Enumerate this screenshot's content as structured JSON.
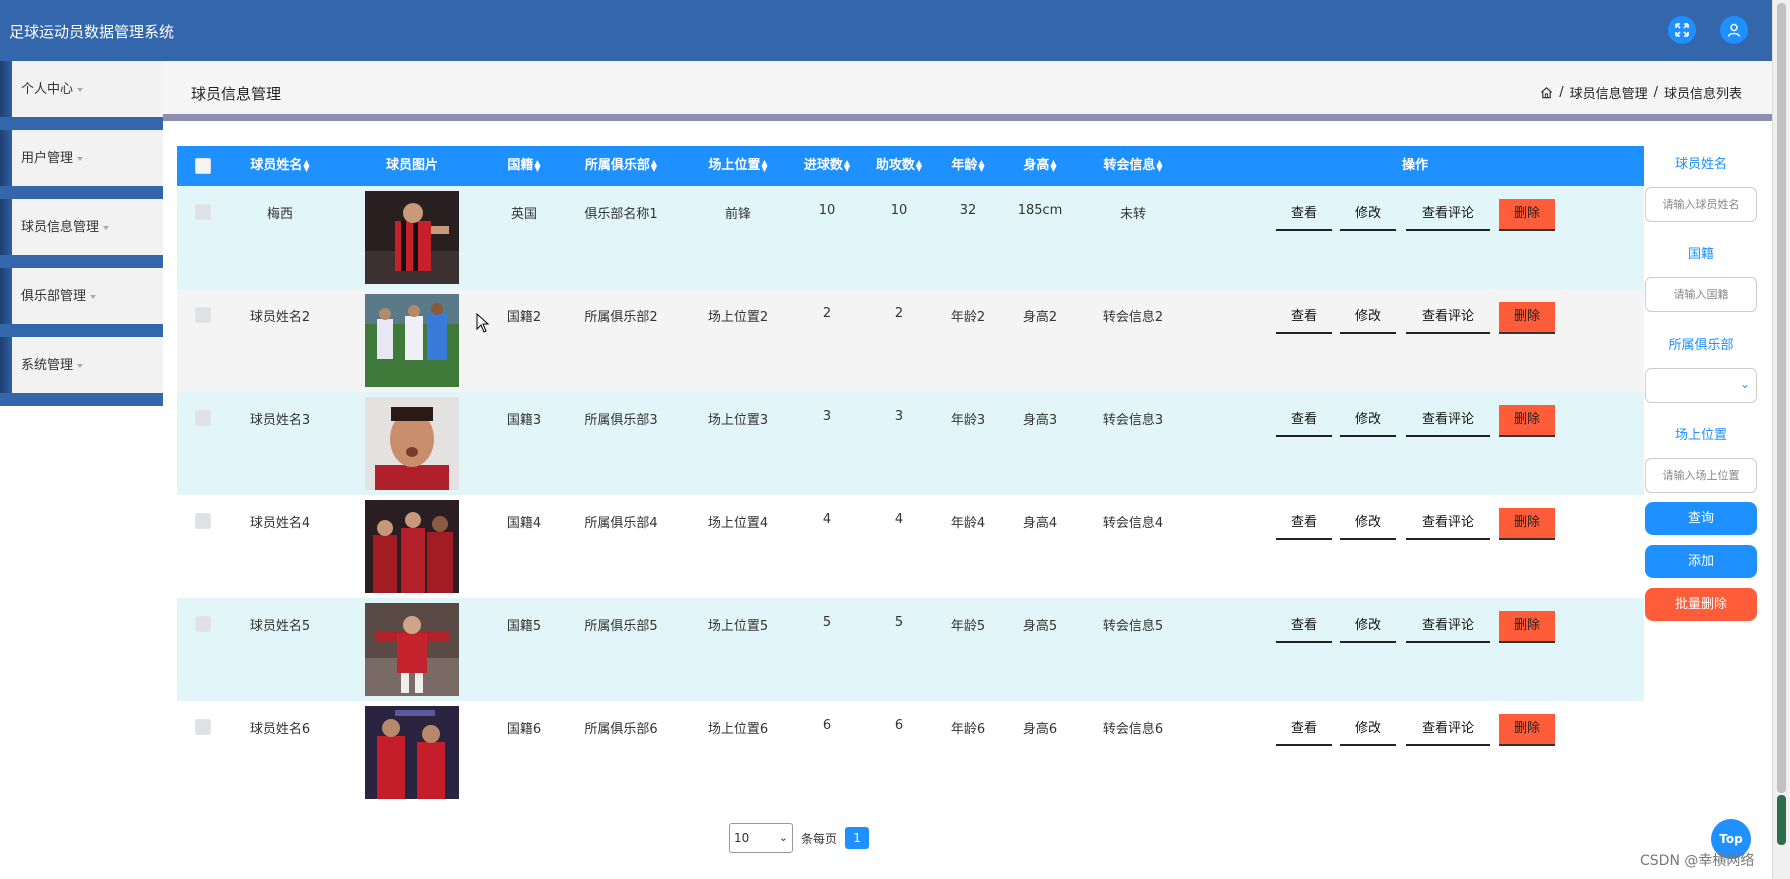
{
  "app": {
    "title": "足球运动员数据管理系统"
  },
  "header": {
    "icons": [
      "fullscreen-icon",
      "user-icon"
    ]
  },
  "sidebar": {
    "items": [
      {
        "label": "个人中心"
      },
      {
        "label": "用户管理"
      },
      {
        "label": "球员信息管理"
      },
      {
        "label": "俱乐部管理"
      },
      {
        "label": "系统管理"
      }
    ]
  },
  "page": {
    "title": "球员信息管理",
    "breadcrumb": {
      "sep": "/",
      "items": [
        "球员信息管理",
        "球员信息列表"
      ]
    }
  },
  "table": {
    "headers": {
      "name": "球员姓名",
      "photo": "球员图片",
      "nationality": "国籍",
      "club": "所属俱乐部",
      "position": "场上位置",
      "goals": "进球数",
      "assists": "助攻数",
      "age": "年龄",
      "height": "身高",
      "transfer": "转会信息",
      "actions": "操作"
    },
    "action_labels": {
      "view": "查看",
      "edit": "修改",
      "comments": "查看评论",
      "delete": "删除"
    },
    "rows": [
      {
        "name": "梅西",
        "nationality": "英国",
        "club": "俱乐部名称1",
        "position": "前锋",
        "goals": "10",
        "assists": "10",
        "age": "32",
        "height": "185cm",
        "transfer": "未转"
      },
      {
        "name": "球员姓名2",
        "nationality": "国籍2",
        "club": "所属俱乐部2",
        "position": "场上位置2",
        "goals": "2",
        "assists": "2",
        "age": "年龄2",
        "height": "身高2",
        "transfer": "转会信息2"
      },
      {
        "name": "球员姓名3",
        "nationality": "国籍3",
        "club": "所属俱乐部3",
        "position": "场上位置3",
        "goals": "3",
        "assists": "3",
        "age": "年龄3",
        "height": "身高3",
        "transfer": "转会信息3"
      },
      {
        "name": "球员姓名4",
        "nationality": "国籍4",
        "club": "所属俱乐部4",
        "position": "场上位置4",
        "goals": "4",
        "assists": "4",
        "age": "年龄4",
        "height": "身高4",
        "transfer": "转会信息4"
      },
      {
        "name": "球员姓名5",
        "nationality": "国籍5",
        "club": "所属俱乐部5",
        "position": "场上位置5",
        "goals": "5",
        "assists": "5",
        "age": "年龄5",
        "height": "身高5",
        "transfer": "转会信息5"
      },
      {
        "name": "球员姓名6",
        "nationality": "国籍6",
        "club": "所属俱乐部6",
        "position": "场上位置6",
        "goals": "6",
        "assists": "6",
        "age": "年龄6",
        "height": "身高6",
        "transfer": "转会信息6"
      }
    ]
  },
  "search": {
    "name_label": "球员姓名",
    "name_placeholder": "请输入球员姓名",
    "nationality_label": "国籍",
    "nationality_placeholder": "请输入国籍",
    "club_label": "所属俱乐部",
    "club_value": "",
    "position_label": "场上位置",
    "position_placeholder": "请输入场上位置",
    "query_button": "查询",
    "add_button": "添加",
    "batch_delete_button": "批量删除"
  },
  "pagination": {
    "page_size": "10",
    "per_page_label": "条每页",
    "current_page": "1"
  },
  "top_button": "Top",
  "watermark": "CSDN @幸横网络",
  "colors": {
    "header": "#3366aa",
    "accent": "#1e90ff",
    "danger": "#ff5c3a"
  }
}
